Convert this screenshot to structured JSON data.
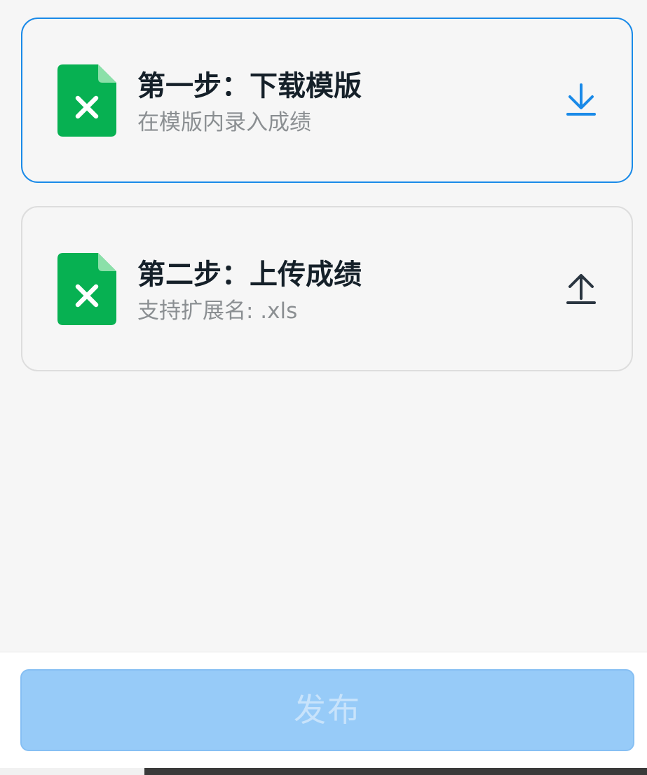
{
  "steps": [
    {
      "title": "第一步：下载模版",
      "subtitle": "在模版内录入成绩",
      "file_icon": "excel-file-icon",
      "action_icon": "download-icon",
      "state": "active"
    },
    {
      "title": "第二步：上传成绩",
      "subtitle": "支持扩展名: .xls",
      "file_icon": "excel-file-icon",
      "action_icon": "upload-icon",
      "state": "inactive"
    }
  ],
  "footer": {
    "publish_label": "发布",
    "publish_state": "disabled"
  },
  "colors": {
    "accent": "#1a8ae8",
    "excel_green": "#07b152",
    "title_text": "#152029",
    "subtitle_text": "#8b8f92",
    "button_disabled_bg": "#97cbf8",
    "button_disabled_text": "#c8e3fb",
    "upload_icon": "#2a3540"
  }
}
